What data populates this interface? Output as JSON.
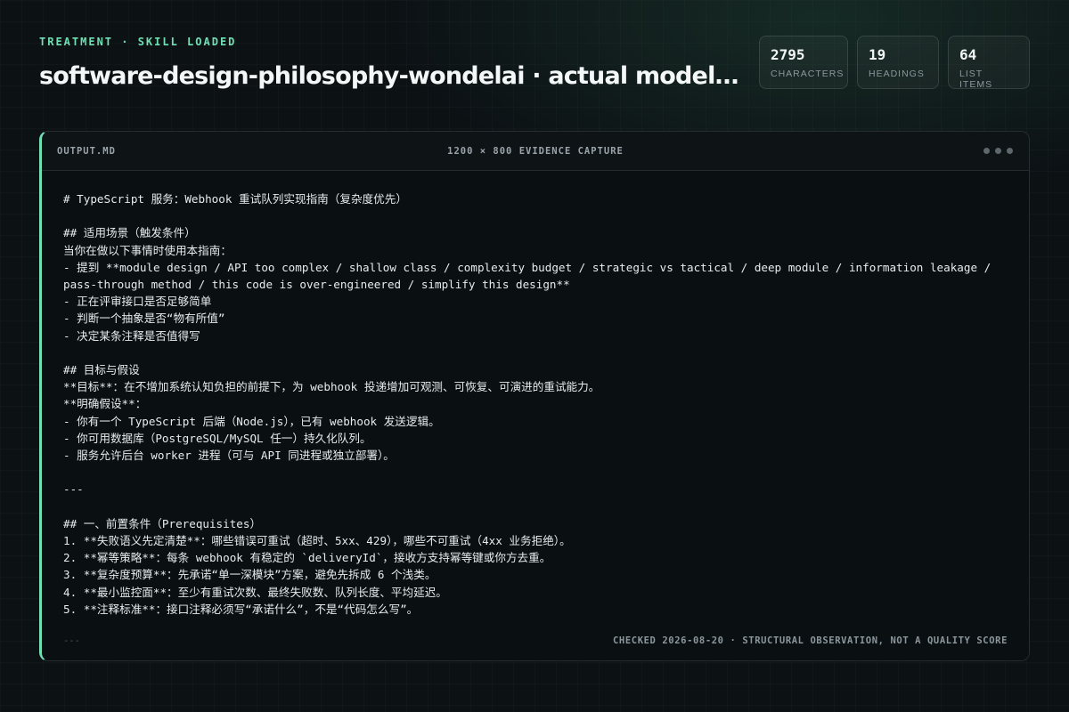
{
  "header": {
    "eyebrow": "TREATMENT · SKILL LOADED",
    "title": "software-design-philosophy-wondelai · actual model ar..."
  },
  "stats": [
    {
      "value": "2795",
      "label": "CHARACTERS"
    },
    {
      "value": "19",
      "label": "HEADINGS"
    },
    {
      "value": "64",
      "label": "LIST ITEMS"
    }
  ],
  "panel": {
    "filename": "OUTPUT.MD",
    "caption": "1200 × 800 EVIDENCE CAPTURE",
    "lines": [
      "# TypeScript 服务：Webhook 重试队列实现指南（复杂度优先）",
      "",
      "## 适用场景（触发条件）",
      "当你在做以下事情时使用本指南：",
      "- 提到 **module design / API too complex / shallow class / complexity budget / strategic vs tactical / deep module / information leakage / pass-through method / this code is over-engineered / simplify this design**",
      "- 正在评审接口是否足够简单",
      "- 判断一个抽象是否“物有所值”",
      "- 决定某条注释是否值得写",
      "",
      "## 目标与假设",
      "**目标**：在不增加系统认知负担的前提下，为 webhook 投递增加可观测、可恢复、可演进的重试能力。",
      "**明确假设**：",
      "- 你有一个 TypeScript 后端（Node.js），已有 webhook 发送逻辑。",
      "- 你可用数据库（PostgreSQL/MySQL 任一）持久化队列。",
      "- 服务允许后台 worker 进程（可与 API 同进程或独立部署）。",
      "",
      "---",
      "",
      "## 一、前置条件（Prerequisites）",
      "1. **失败语义先定清楚**：哪些错误可重试（超时、5xx、429），哪些不可重试（4xx 业务拒绝）。",
      "2. **幂等策略**：每条 webhook 有稳定的 `deliveryId`，接收方支持幂等键或你方去重。",
      "3. **复杂度预算**：先承诺“单一深模块”方案，避免先拆成 6 个浅类。",
      "4. **最小监控面**：至少有重试次数、最终失败数、队列长度、平均延迟。",
      "5. **注释标准**：接口注释必须写“承诺什么”，不是“代码怎么写”。"
    ],
    "footer_rule": "---",
    "footer_note": "CHECKED 2026-08-20 · STRUCTURAL OBSERVATION, NOT A QUALITY SCORE"
  }
}
